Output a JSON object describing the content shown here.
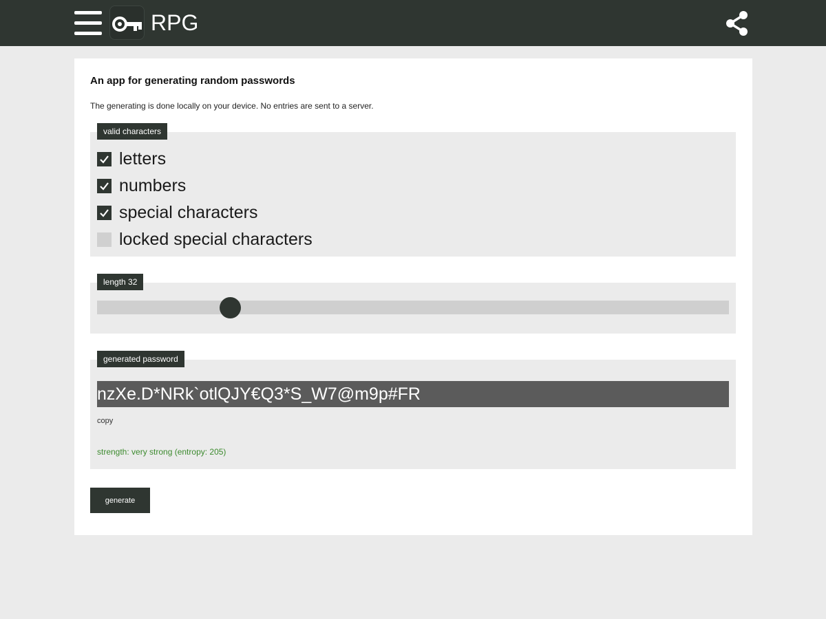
{
  "appbar": {
    "title": "RPG",
    "menu_icon": "hamburger-menu-icon",
    "logo_icon": "key-icon",
    "share_icon": "share-icon",
    "bg_color": "#2f3631"
  },
  "card": {
    "heading": "An app for generating random passwords",
    "description": "The generating is done locally on your device. No entries are sent to a server."
  },
  "characters": {
    "label": "valid characters",
    "options": [
      {
        "label": "letters",
        "checked": true
      },
      {
        "label": "numbers",
        "checked": true
      },
      {
        "label": "special characters",
        "checked": true
      },
      {
        "label": "locked special characters",
        "checked": false
      }
    ]
  },
  "length": {
    "label": "length 32",
    "value": 32,
    "fraction": 0.21
  },
  "password": {
    "label": "generated password",
    "value": "nzXe.D*NRk`otlQJY€Q3*S_W7@m9p#FR",
    "copy_label": "copy",
    "strength_text": "strength: very strong (entropy: 205)",
    "strength_color": "#3c8a2e"
  },
  "actions": {
    "generate_label": "generate"
  }
}
